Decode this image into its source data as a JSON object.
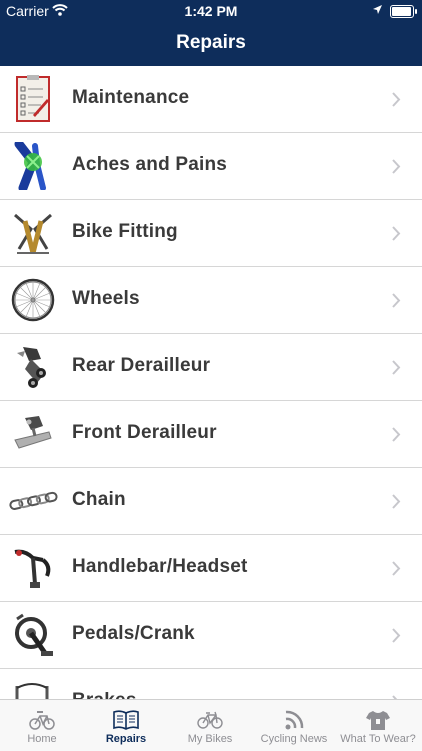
{
  "status_bar": {
    "carrier": "Carrier",
    "time": "1:42 PM"
  },
  "nav": {
    "title": "Repairs"
  },
  "items": [
    {
      "label": "Maintenance",
      "icon": "checklist-icon"
    },
    {
      "label": "Aches and Pains",
      "icon": "knee-icon"
    },
    {
      "label": "Bike Fitting",
      "icon": "bike-fitting-icon"
    },
    {
      "label": "Wheels",
      "icon": "wheel-icon"
    },
    {
      "label": "Rear Derailleur",
      "icon": "rear-derailleur-icon"
    },
    {
      "label": "Front Derailleur",
      "icon": "front-derailleur-icon"
    },
    {
      "label": "Chain",
      "icon": "chain-icon"
    },
    {
      "label": "Handlebar/Headset",
      "icon": "handlebar-icon"
    },
    {
      "label": "Pedals/Crank",
      "icon": "crankset-icon"
    },
    {
      "label": "Brakes",
      "icon": "brake-icon"
    }
  ],
  "tabs": [
    {
      "label": "Home",
      "icon": "bike-logo-icon",
      "active": false
    },
    {
      "label": "Repairs",
      "icon": "book-icon",
      "active": true
    },
    {
      "label": "My Bikes",
      "icon": "bicycle-icon",
      "active": false
    },
    {
      "label": "Cycling News",
      "icon": "rss-icon",
      "active": false
    },
    {
      "label": "What To Wear?",
      "icon": "shirt-icon",
      "active": false
    }
  ],
  "colors": {
    "header": "#0e2d5b",
    "active_tab": "#0e2d5b",
    "inactive_tab": "#8e8e93"
  }
}
